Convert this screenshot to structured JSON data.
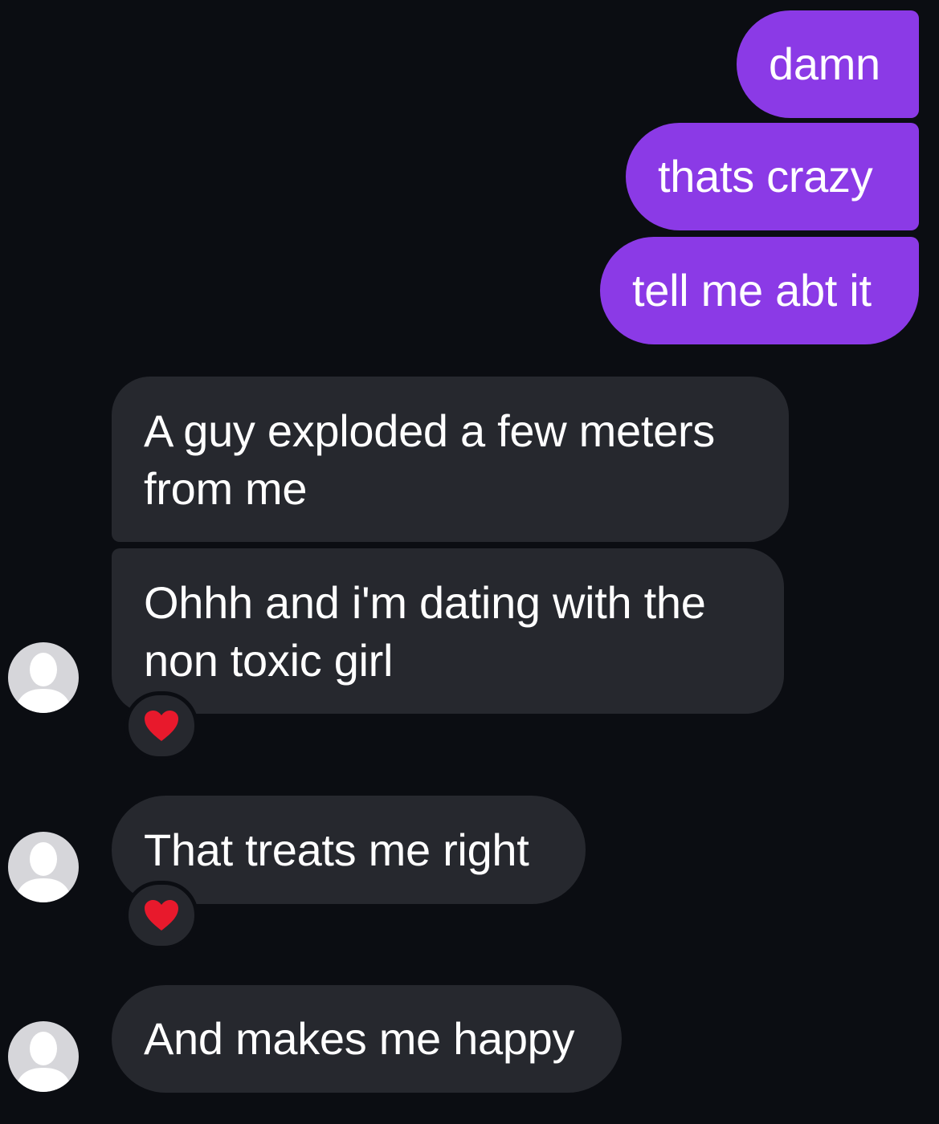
{
  "messages": {
    "sent": [
      {
        "text": "damn"
      },
      {
        "text": "thats crazy"
      },
      {
        "text": "tell me abt it"
      }
    ],
    "received": [
      {
        "line1": "A guy exploded a few meters",
        "line2": "from me"
      },
      {
        "line1": "Ohhh and i'm dating with the",
        "line2": "non toxic girl",
        "reaction": "heart-icon"
      },
      {
        "text": "That treats me right",
        "reaction": "heart-icon"
      },
      {
        "text": "And makes me happy"
      }
    ]
  },
  "colors": {
    "background": "#0b0d12",
    "sent_bubble": "#8b3ae6",
    "received_bubble": "#26282e",
    "avatar": "#d6d6da",
    "heart": "#e8192c"
  }
}
